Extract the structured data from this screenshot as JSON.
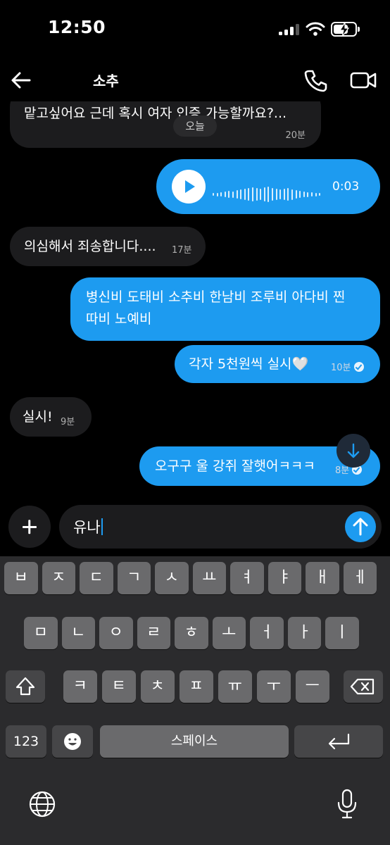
{
  "status_bar": {
    "time": "12:50"
  },
  "header": {
    "contact_name": "소추"
  },
  "messages": {
    "top_partial": {
      "text": "맡고싶어요 근데 혹시 여자 인증 가능할까요?...",
      "time": "20분"
    },
    "date_divider": "오늘",
    "voice": {
      "duration": "0:03"
    },
    "m1": {
      "text": "의심해서 죄송합니다....",
      "time": "17분"
    },
    "m2": {
      "line1": "병신비 도태비 소추비 한남비 조루비 아다비 찐",
      "line2": "따비 노예비"
    },
    "m3": {
      "text": "각자 5천원씩 실시🤍",
      "time": "10분"
    },
    "m4": {
      "text": "실시!",
      "time": "9분"
    },
    "m5": {
      "text": "오구구 울 강쥐 잘햇어ㅋㅋㅋ",
      "time": "8분"
    }
  },
  "composer": {
    "value": "유나"
  },
  "keyboard": {
    "row1": [
      "ㅂ",
      "ㅈ",
      "ㄷ",
      "ㄱ",
      "ㅅ",
      "ㅛ",
      "ㅕ",
      "ㅑ",
      "ㅐ",
      "ㅔ"
    ],
    "row2": [
      "ㅁ",
      "ㄴ",
      "ㅇ",
      "ㄹ",
      "ㅎ",
      "ㅗ",
      "ㅓ",
      "ㅏ",
      "ㅣ"
    ],
    "row3": [
      "ㅋ",
      "ㅌ",
      "ㅊ",
      "ㅍ",
      "ㅠ",
      "ㅜ",
      "ㅡ"
    ],
    "numbers_label": "123",
    "space_label": "스페이스"
  },
  "colors": {
    "accent": "#1d9bf0",
    "incoming_bubble": "#1c1c1e",
    "keyboard_bg": "#2b2b2d"
  }
}
